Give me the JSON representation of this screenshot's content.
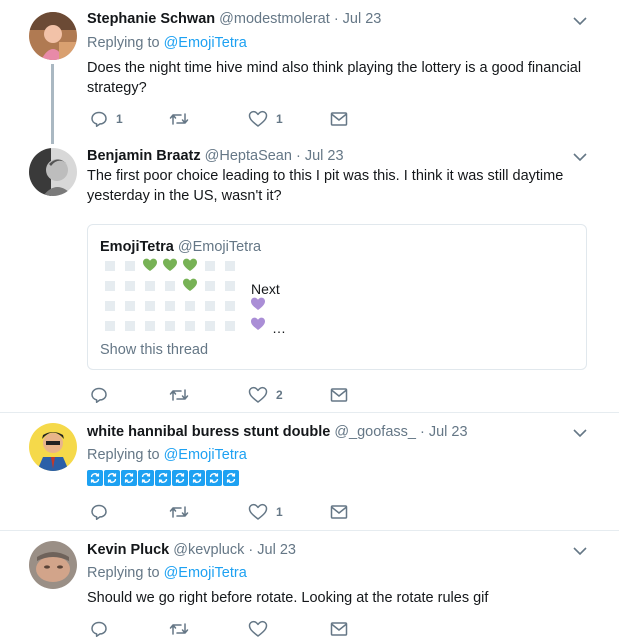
{
  "colors": {
    "accent": "#1da1f2",
    "muted": "#657786",
    "separator": "#e6ecf0",
    "thread_line": "#aab8c2",
    "heart_green": "#77b255",
    "heart_purple": "#aa8ed6",
    "grid_square": "#e6ecf0"
  },
  "tweets": [
    {
      "name": "Stephanie Schwan",
      "handle": "@modestmolerat",
      "date": "· Jul 23",
      "replying_label": "Replying to",
      "replying_to": "@EmojiTetra",
      "text": "Does the night time hive mind also think playing the lottery is a good financial strategy?",
      "replies": "1",
      "retweets": "",
      "likes": "1"
    },
    {
      "name": "Benjamin Braatz",
      "handle": "@HeptaSean",
      "date": "· Jul 23",
      "text": "The first poor choice leading to this I pit was this. I think it was still daytime yesterday in the US, wasn't it?",
      "replies": "",
      "retweets": "",
      "likes": "2",
      "quote": {
        "name": "EmojiTetra",
        "handle": "@EmojiTetra",
        "next_label": "Next",
        "ellipsis": "…",
        "show_thread": "Show this thread"
      }
    },
    {
      "name": "white hannibal buress stunt double",
      "handle": "@_goofass_",
      "date": "· Jul 23",
      "replying_label": "Replying to",
      "replying_to": "@EmojiTetra",
      "rotate_emoji_count": 9,
      "replies": "",
      "retweets": "",
      "likes": "1"
    },
    {
      "name": "Kevin Pluck",
      "handle": "@kevpluck",
      "date": "· Jul 23",
      "replying_label": "Replying to",
      "replying_to": "@EmojiTetra",
      "text": "Should we go right before rotate.  Looking at the rotate rules gif",
      "replies": "",
      "retweets": "",
      "likes": ""
    }
  ]
}
